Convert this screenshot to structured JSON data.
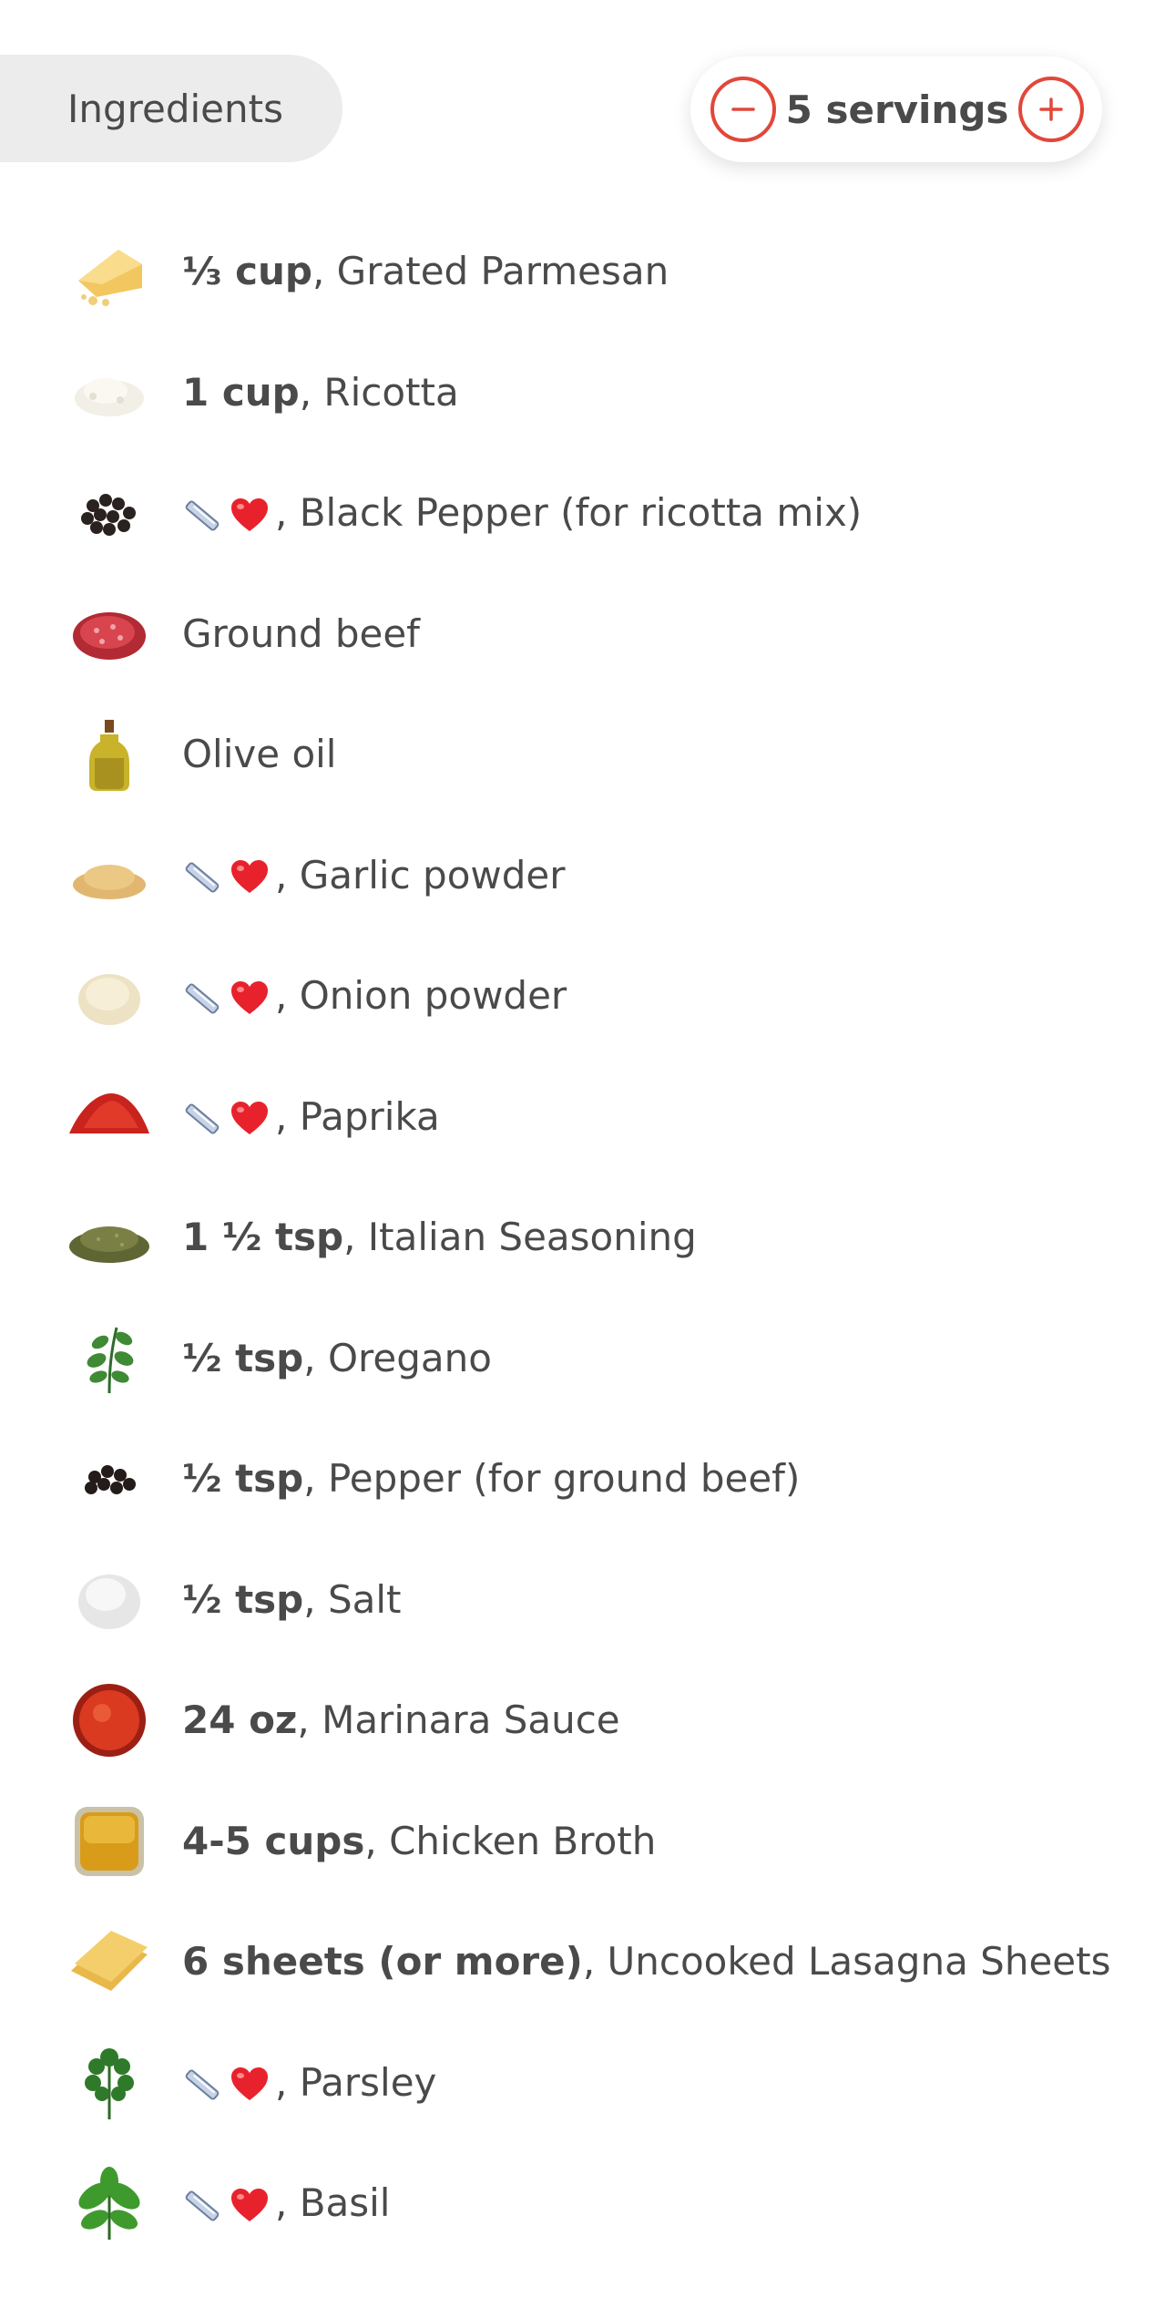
{
  "header": {
    "tab_label": "Ingredients",
    "servings_label": "5 servings",
    "decrease_icon": "minus-circle-icon",
    "increase_icon": "plus-circle-icon",
    "accent_color": "#e2473a"
  },
  "ingredients": [
    {
      "icon": "parmesan-icon",
      "qty": "⅓ cup",
      "sep": ", ",
      "name": "Grated Parmesan"
    },
    {
      "icon": "ricotta-icon",
      "qty": "1 cup",
      "sep": ", ",
      "name": "Ricotta"
    },
    {
      "icon": "black-pepper-icon",
      "qty": "",
      "sep": ", ",
      "name": "Black Pepper (for ricotta mix)",
      "to_taste": true
    },
    {
      "icon": "ground-beef-icon",
      "qty": "",
      "sep": "",
      "name": "Ground beef"
    },
    {
      "icon": "olive-oil-icon",
      "qty": "",
      "sep": "",
      "name": "Olive oil"
    },
    {
      "icon": "garlic-powder-icon",
      "qty": "",
      "sep": ", ",
      "name": "Garlic powder",
      "to_taste": true
    },
    {
      "icon": "onion-powder-icon",
      "qty": "",
      "sep": ", ",
      "name": "Onion powder",
      "to_taste": true
    },
    {
      "icon": "paprika-icon",
      "qty": "",
      "sep": ", ",
      "name": "Paprika",
      "to_taste": true
    },
    {
      "icon": "italian-seasoning-icon",
      "qty": "1 ½ tsp",
      "sep": ", ",
      "name": "Italian Seasoning"
    },
    {
      "icon": "oregano-icon",
      "qty": "½ tsp",
      "sep": ", ",
      "name": "Oregano"
    },
    {
      "icon": "pepper-icon",
      "qty": "½ tsp",
      "sep": ", ",
      "name": "Pepper (for ground beef)"
    },
    {
      "icon": "salt-icon",
      "qty": "½ tsp",
      "sep": ", ",
      "name": "Salt"
    },
    {
      "icon": "marinara-sauce-icon",
      "qty": "24 oz",
      "sep": ", ",
      "name": "Marinara Sauce"
    },
    {
      "icon": "chicken-broth-icon",
      "qty": "4-5 cups",
      "sep": ", ",
      "name": "Chicken Broth"
    },
    {
      "icon": "lasagna-sheets-icon",
      "qty": "6 sheets (or more)",
      "sep": ", ",
      "name": "Uncooked Lasagna Sheets"
    },
    {
      "icon": "parsley-icon",
      "qty": "",
      "sep": ", ",
      "name": "Parsley",
      "to_taste": true
    },
    {
      "icon": "basil-icon",
      "qty": "",
      "sep": ", ",
      "name": "Basil",
      "to_taste": true
    }
  ]
}
